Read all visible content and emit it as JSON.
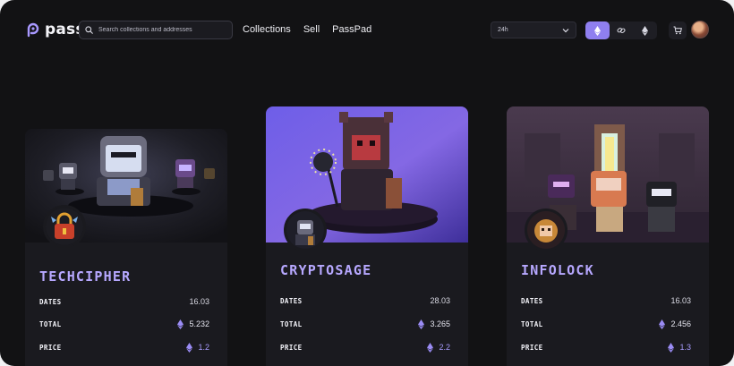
{
  "brand": {
    "name": "pass"
  },
  "search": {
    "placeholder": "Search collections and addresses"
  },
  "menu": {
    "items": [
      "Collections",
      "Sell",
      "PassPad"
    ]
  },
  "time_filter": {
    "selected": "24h"
  },
  "chains": [
    "ethereum-icon",
    "link-icon",
    "ethereum-outline-icon"
  ],
  "colors": {
    "accent": "#8f7ff0",
    "title": "#b7a8ff",
    "background": "#121214",
    "card": "#1a1a1f"
  },
  "cards": [
    {
      "title": "TECHCIPHER",
      "labels": {
        "dates": "DATES",
        "total": "TOTAL",
        "price": "PRICE"
      },
      "dates": "16.03",
      "total": "5.232",
      "price": "1.2"
    },
    {
      "title": "CRYPTOSAGE",
      "labels": {
        "dates": "DATES",
        "total": "TOTAL",
        "price": "PRICE"
      },
      "dates": "28.03",
      "total": "3.265",
      "price": "2.2"
    },
    {
      "title": "INFOLOCK",
      "labels": {
        "dates": "DATES",
        "total": "TOTAL",
        "price": "PRICE"
      },
      "dates": "16.03",
      "total": "2.456",
      "price": "1.3"
    }
  ]
}
